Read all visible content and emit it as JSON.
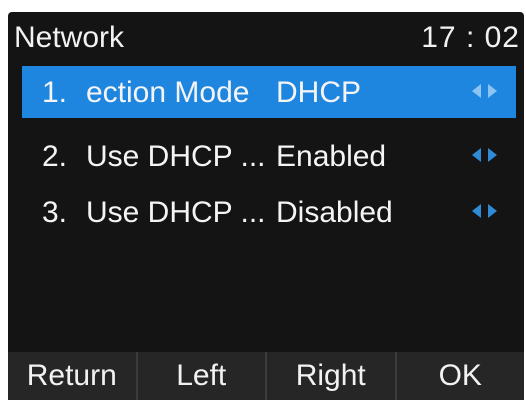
{
  "status": {
    "title": "Network",
    "time": "17 : 02"
  },
  "list": {
    "items": [
      {
        "index": "1.",
        "label": "ection Mode",
        "value": "DHCP",
        "selected": true
      },
      {
        "index": "2.",
        "label": "Use DHCP ...",
        "value": "Enabled",
        "selected": false
      },
      {
        "index": "3.",
        "label": "Use DHCP ...",
        "value": "Disabled",
        "selected": false
      }
    ],
    "arrow_icons": [
      "arrow-left-icon",
      "arrow-right-icon"
    ],
    "selected_color": "#1f86e0",
    "arrow_color": "#2f8bd6"
  },
  "softkeys": [
    "Return",
    "Left",
    "Right",
    "OK"
  ],
  "colors": {
    "screen_bg": "#141414",
    "softkey_bg": "#262626",
    "text": "#f2f2f2"
  }
}
